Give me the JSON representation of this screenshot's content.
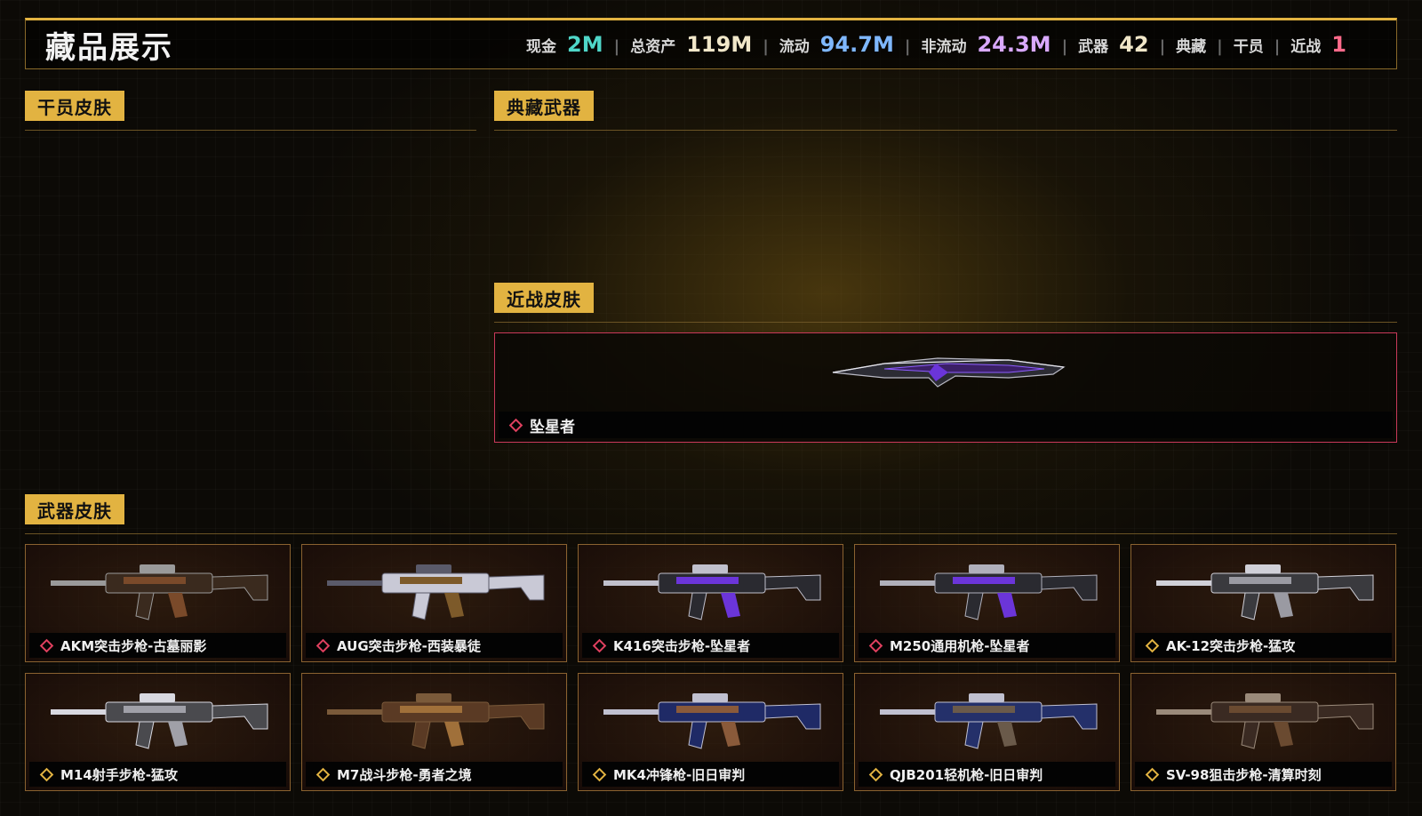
{
  "header": {
    "title": "藏品展示",
    "stats": {
      "cash_label": "现金",
      "cash_value": "2M",
      "total_label": "总资产",
      "total_value": "119M",
      "liquid_label": "流动",
      "liquid_value": "94.7M",
      "illiquid_label": "非流动",
      "illiquid_value": "24.3M",
      "weapons_label": "武器",
      "weapons_value": "42",
      "collection_label": "典藏",
      "operators_label": "干员",
      "melee_label": "近战",
      "melee_value": "1"
    }
  },
  "sections": {
    "operator_skins": "干员皮肤",
    "collection_weapons": "典藏武器",
    "melee_skins": "近战皮肤",
    "weapon_skins": "武器皮肤"
  },
  "melee": {
    "item_name": "坠星者",
    "icon": "knife-icon"
  },
  "weapons": [
    {
      "name": "AKM突击步枪-古墓丽影",
      "icon": "rifle-icon"
    },
    {
      "name": "AUG突击步枪-西装暴徒",
      "icon": "rifle-icon"
    },
    {
      "name": "K416突击步枪-坠星者",
      "icon": "rifle-icon"
    },
    {
      "name": "M250通用机枪-坠星者",
      "icon": "machine-gun-icon"
    },
    {
      "name": "AK-12突击步枪-猛攻",
      "icon": "rifle-icon"
    },
    {
      "name": "M14射手步枪-猛攻",
      "icon": "rifle-icon"
    },
    {
      "name": "M7战斗步枪-勇者之境",
      "icon": "rifle-icon"
    },
    {
      "name": "MK4冲锋枪-旧日审判",
      "icon": "smg-icon"
    },
    {
      "name": "QJB201轻机枪-旧日审判",
      "icon": "machine-gun-icon"
    },
    {
      "name": "SV-98狙击步枪-清算时刻",
      "icon": "sniper-icon"
    }
  ],
  "colors": {
    "accent_gold": "#e2b341",
    "melee_border": "#c9395a",
    "cash": "#4fd6c8",
    "liquid": "#7fb8ff",
    "illiquid": "#d9a9ff",
    "melee_count": "#ff6a8a"
  }
}
